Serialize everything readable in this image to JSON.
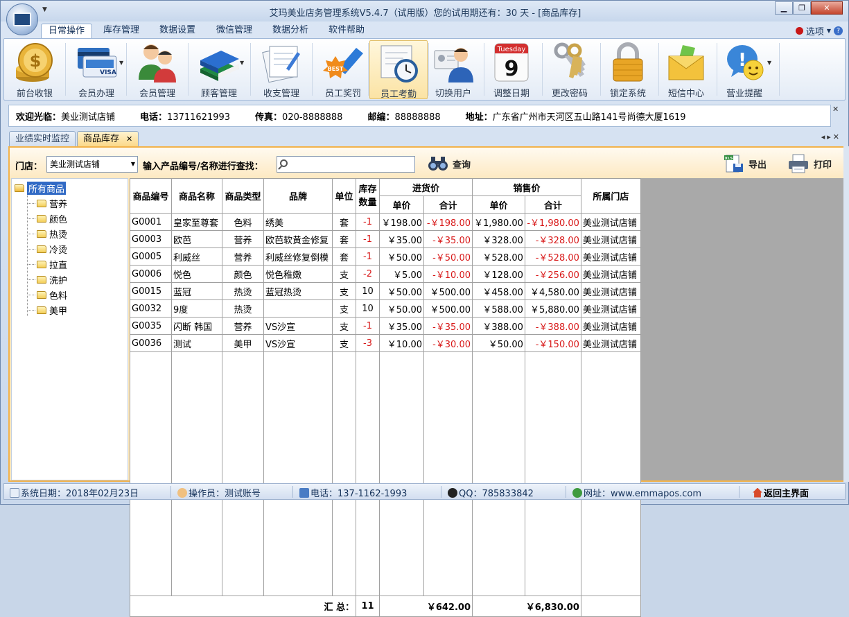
{
  "window": {
    "title": "艾玛美业店务管理系统V5.4.7（试用版）您的试用期还有：30 天 - [商品库存]"
  },
  "ribbon_tabs": [
    "日常操作",
    "库存管理",
    "数据设置",
    "微信管理",
    "数据分析",
    "软件帮助"
  ],
  "options_label": "选项",
  "ribbon_buttons": [
    {
      "label": "前台收银",
      "icon": "coin-stack-icon"
    },
    {
      "label": "会员办理",
      "icon": "member-card-icon"
    },
    {
      "label": "会员管理",
      "icon": "people-icon"
    },
    {
      "label": "顾客管理",
      "icon": "books-icon"
    },
    {
      "label": "收支管理",
      "icon": "ledger-icon"
    },
    {
      "label": "员工奖罚",
      "icon": "best-badge-icon"
    },
    {
      "label": "员工考勤",
      "icon": "attendance-clock-icon"
    },
    {
      "label": "切换用户",
      "icon": "switch-user-icon"
    },
    {
      "label": "调整日期",
      "icon": "calendar-icon"
    },
    {
      "label": "更改密码",
      "icon": "keys-icon"
    },
    {
      "label": "锁定系统",
      "icon": "padlock-icon"
    },
    {
      "label": "短信中心",
      "icon": "envelope-icon"
    },
    {
      "label": "营业提醒",
      "icon": "smiley-alert-icon"
    }
  ],
  "calendar": {
    "weekday": "Tuesday",
    "day": "9"
  },
  "best_badge_text": "BEST",
  "info": {
    "welcome_label": "欢迎光临：",
    "welcome_value": "美业测试店铺",
    "phone_label": "电话：",
    "phone_value": "13711621993",
    "fax_label": "传真：",
    "fax_value": "020-8888888",
    "zip_label": "邮编：",
    "zip_value": "88888888",
    "address_label": "地址：",
    "address_value": "广东省广州市天河区五山路141号尚德大厦1619"
  },
  "doc_tabs": [
    "业绩实时监控",
    "商品库存"
  ],
  "toolbar": {
    "store_label": "门店：",
    "store_value": "美业测试店铺",
    "search_label": "输入产品编号/名称进行查找：",
    "search_value": "",
    "query_label": "查询",
    "export_label": "导出",
    "print_label": "打印",
    "xls_badge": "XLS"
  },
  "tree": {
    "root": "所有商品",
    "children": [
      "营养",
      "颜色",
      "热烫",
      "冷烫",
      "拉直",
      "洗护",
      "色料",
      "美甲"
    ]
  },
  "table": {
    "headers": {
      "code": "商品编号",
      "name": "商品名称",
      "type": "商品类型",
      "brand": "品牌",
      "unit": "单位",
      "stock": "库存数量",
      "purchase": "进货价",
      "sale": "销售价",
      "unit_price": "单价",
      "total": "合计",
      "store": "所属门店"
    },
    "rows": [
      {
        "code": "G0001",
        "name": "皇家至尊套",
        "type": "色料",
        "brand": "绣美",
        "unit": "套",
        "stock": "-1",
        "p_price": "￥198.00",
        "p_total": "-￥198.00",
        "s_price": "￥1,980.00",
        "s_total": "-￥1,980.00",
        "store": "美业测试店铺"
      },
      {
        "code": "G0003",
        "name": "欧芭",
        "type": "营养",
        "brand": "欧芭软黄金修复",
        "unit": "套",
        "stock": "-1",
        "p_price": "￥35.00",
        "p_total": "-￥35.00",
        "s_price": "￥328.00",
        "s_total": "-￥328.00",
        "store": "美业测试店铺"
      },
      {
        "code": "G0005",
        "name": "利威丝",
        "type": "营养",
        "brand": "利威丝修复倒模",
        "unit": "套",
        "stock": "-1",
        "p_price": "￥50.00",
        "p_total": "-￥50.00",
        "s_price": "￥528.00",
        "s_total": "-￥528.00",
        "store": "美业测试店铺"
      },
      {
        "code": "G0006",
        "name": "悦色",
        "type": "颜色",
        "brand": "悦色稚嫩",
        "unit": "支",
        "stock": "-2",
        "p_price": "￥5.00",
        "p_total": "-￥10.00",
        "s_price": "￥128.00",
        "s_total": "-￥256.00",
        "store": "美业测试店铺"
      },
      {
        "code": "G0015",
        "name": "蓝冠",
        "type": "热烫",
        "brand": "蓝冠热烫",
        "unit": "支",
        "stock": "10",
        "p_price": "￥50.00",
        "p_total": "￥500.00",
        "s_price": "￥458.00",
        "s_total": "￥4,580.00",
        "store": "美业测试店铺"
      },
      {
        "code": "G0032",
        "name": "9度",
        "type": "热烫",
        "brand": "",
        "unit": "支",
        "stock": "10",
        "p_price": "￥50.00",
        "p_total": "￥500.00",
        "s_price": "￥588.00",
        "s_total": "￥5,880.00",
        "store": "美业测试店铺"
      },
      {
        "code": "G0035",
        "name": "闪断 韩国",
        "type": "营养",
        "brand": "VS沙宣",
        "unit": "支",
        "stock": "-1",
        "p_price": "￥35.00",
        "p_total": "-￥35.00",
        "s_price": "￥388.00",
        "s_total": "-￥388.00",
        "store": "美业测试店铺"
      },
      {
        "code": "G0036",
        "name": "测试",
        "type": "美甲",
        "brand": "VS沙宣",
        "unit": "支",
        "stock": "-3",
        "p_price": "￥10.00",
        "p_total": "-￥30.00",
        "s_price": "￥50.00",
        "s_total": "-￥150.00",
        "store": "美业测试店铺"
      }
    ],
    "summary": {
      "label": "汇 总：",
      "stock": "11",
      "p_total": "￥642.00",
      "s_total": "￥6,830.00"
    }
  },
  "status": {
    "date": "系统日期：2018年02月23日",
    "operator": "操作员：测试账号",
    "phone": "电话：137-1162-1993",
    "qq": "QQ：785833842",
    "website": "网址：www.emmapos.com",
    "home": "返回主界面"
  },
  "colors": {
    "accent": "#f2b24a",
    "negative": "#d81818",
    "selection": "#316ac5"
  }
}
